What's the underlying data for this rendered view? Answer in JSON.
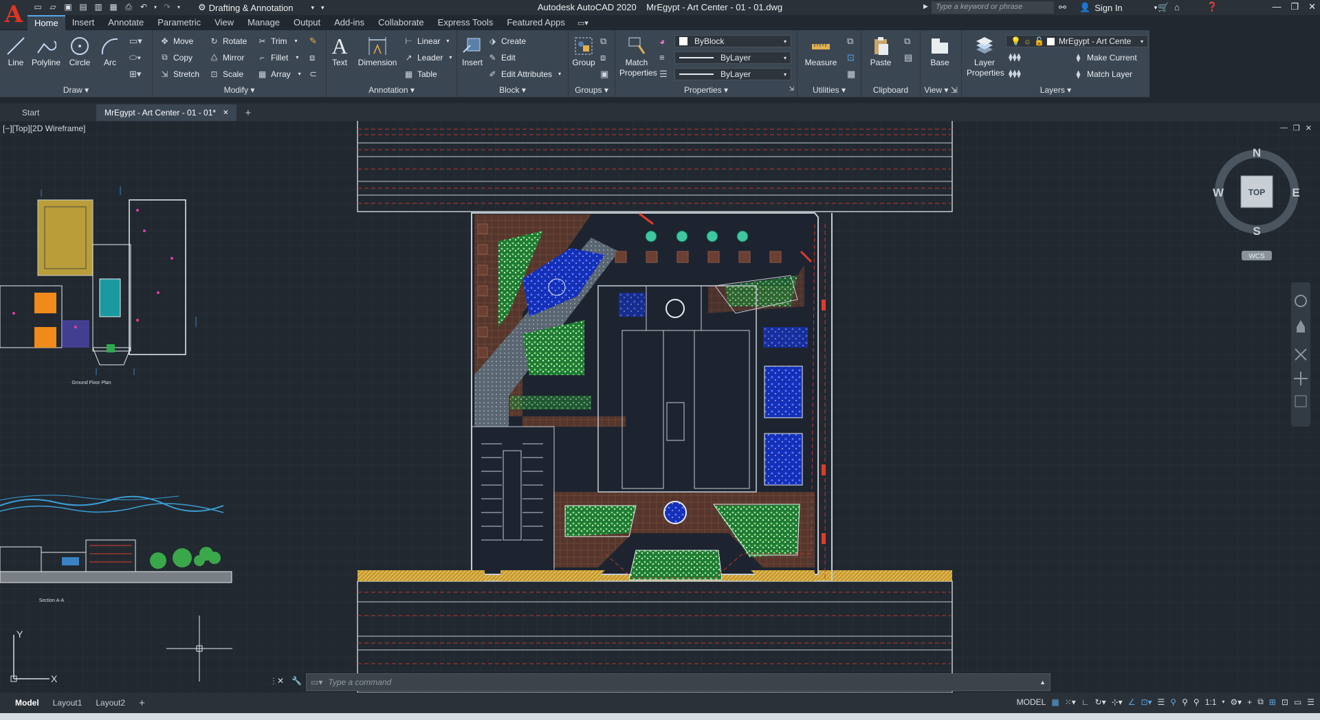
{
  "app": {
    "title": "Autodesk AutoCAD 2020",
    "document": "MrEgypt - Art Center - 01 - 01.dwg"
  },
  "workspace": {
    "label": "Drafting & Annotation"
  },
  "search": {
    "placeholder": "Type a keyword or phrase"
  },
  "account": {
    "signin": "Sign In"
  },
  "menus": [
    "Home",
    "Insert",
    "Annotate",
    "Parametric",
    "View",
    "Manage",
    "Output",
    "Add-ins",
    "Collaborate",
    "Express Tools",
    "Featured Apps"
  ],
  "ribbon": {
    "draw": {
      "title": "Draw",
      "line": "Line",
      "polyline": "Polyline",
      "circle": "Circle",
      "arc": "Arc"
    },
    "modify": {
      "title": "Modify",
      "move": "Move",
      "rotate": "Rotate",
      "trim": "Trim",
      "copy": "Copy",
      "mirror": "Mirror",
      "fillet": "Fillet",
      "stretch": "Stretch",
      "scale": "Scale",
      "array": "Array"
    },
    "annotation": {
      "title": "Annotation",
      "text": "Text",
      "dimension": "Dimension",
      "linear": "Linear",
      "leader": "Leader",
      "table": "Table"
    },
    "block": {
      "title": "Block",
      "insert": "Insert",
      "create": "Create",
      "edit": "Edit",
      "edit_attributes": "Edit Attributes"
    },
    "groups": {
      "title": "Groups",
      "group": "Group"
    },
    "properties": {
      "title": "Properties",
      "match": "Match Properties",
      "color": "ByBlock",
      "linetype": "ByLayer",
      "lineweight": "ByLayer"
    },
    "utilities": {
      "title": "Utilities",
      "measure": "Measure"
    },
    "clipboard": {
      "title": "Clipboard",
      "paste": "Paste"
    },
    "view": {
      "title": "View",
      "base": "Base"
    },
    "layers": {
      "title": "Layers",
      "layer_properties": "Layer Properties",
      "layer_name": "MrEgypt - Art Cente",
      "make_current": "Make Current",
      "match_layer": "Match Layer"
    }
  },
  "file_tabs": {
    "start": "Start",
    "doc": "MrEgypt - Art Center - 01 - 01*"
  },
  "viewport": {
    "label": "[−][Top][2D Wireframe]"
  },
  "drawing": {
    "ground_floor": "Ground Floor Plan",
    "section": "Section A-A"
  },
  "viewcube": {
    "n": "N",
    "s": "S",
    "e": "E",
    "w": "W",
    "top": "TOP",
    "wcs": "WCS"
  },
  "ucs": {
    "y": "Y",
    "x": "X"
  },
  "command": {
    "placeholder": "Type a command"
  },
  "layout_tabs": [
    "Model",
    "Layout1",
    "Layout2"
  ],
  "status": {
    "model": "MODEL",
    "scale": "1:1"
  },
  "colors": {
    "ribbon": "#3b4653",
    "canvas": "#212830",
    "accent": "#5aa6e6",
    "road_line": "#c0392b",
    "green": "#2fa84f",
    "blue": "#1f3fe0",
    "brown": "#5e3b2e"
  }
}
